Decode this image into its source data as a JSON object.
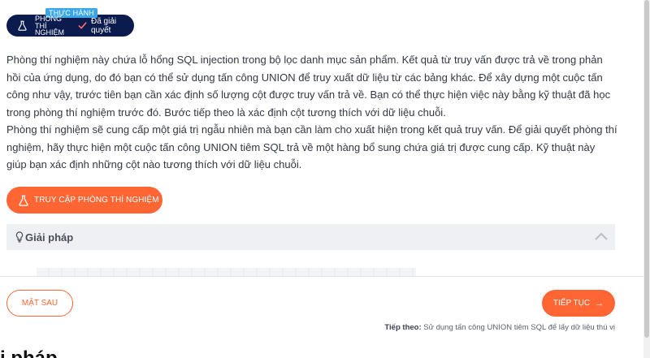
{
  "badge": {
    "tag": "THỰC HÀNH",
    "lab_label": "PHÒNG THÍ NGHIỆM",
    "status": "Đã giải quyết"
  },
  "description": {
    "paragraph1": "Phòng thí nghiệm này chứa lỗ hổng SQL injection trong bộ lọc danh mục sản phẩm. Kết quả từ truy vấn được trả về trong phản hồi của ứng dụng, do đó bạn có thể sử dụng tấn công UNION để truy xuất dữ liệu từ các bảng khác. Để xây dựng một cuộc tấn công như vậy, trước tiên bạn cần xác định số lượng cột được truy vấn trả về. Bạn có thể thực hiện việc này bằng kỹ thuật đã học trong phòng thí nghiệm trước đó. Bước tiếp theo là xác định cột tương thích với dữ liệu chuỗi.",
    "paragraph2": "Phòng thí nghiệm sẽ cung cấp một giá trị ngẫu nhiên mà bạn cần làm cho xuất hiện trong kết quả truy vấn. Để giải quyết phòng thí nghiệm, hãy thực hiện một cuộc tấn công UNION tiêm SQL trả về một hàng bổ sung chứa giá trị được cung cấp. Kỹ thuật này giúp bạn xác định những cột nào tương thích với dữ liệu chuỗi."
  },
  "access_button": {
    "label": "TRUY CẬP PHÒNG THÍ NGHIỆM",
    "icon": "flask-icon"
  },
  "solution": {
    "title": "Giải pháp",
    "icon": "lightbulb-icon",
    "expanded": true
  },
  "footer": {
    "back_label": "MẶT SAU",
    "next_label": "TIẾP TỤC",
    "next_hint_prefix": "Tiếp theo:",
    "next_hint_text": "Sử dụng tấn công UNION tiêm SQL để lấy dữ liệu thú vị"
  },
  "lower_heading": "i pháp",
  "colors": {
    "accent": "#ff6633",
    "badge_bg": "#0c1b4d",
    "tag_bg": "#3ba7e8",
    "panel_bg": "#eef0f3"
  }
}
